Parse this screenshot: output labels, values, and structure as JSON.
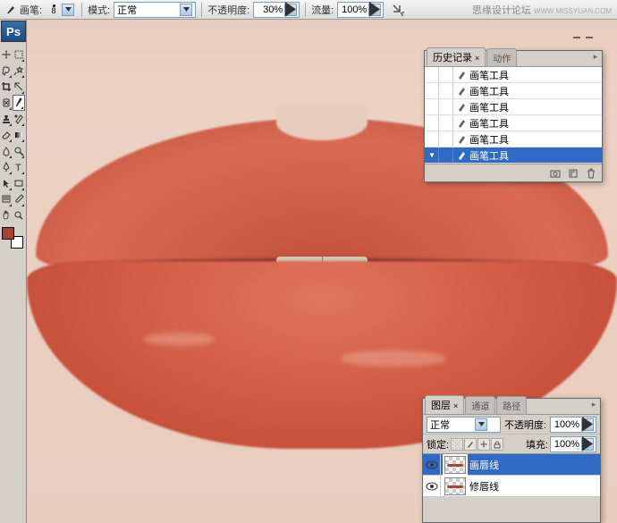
{
  "topbar": {
    "brush_label": "画笔:",
    "brush_size": "8",
    "mode_label": "模式:",
    "mode_value": "正常",
    "opacity_label": "不透明度:",
    "opacity_value": "30%",
    "flow_label": "流量:",
    "flow_value": "100%"
  },
  "watermark": {
    "main": "思缘设计论坛",
    "sub": "WWW.MISSYUAN.COM"
  },
  "tools": [
    "move",
    "marquee",
    "lasso",
    "wand",
    "crop",
    "slice",
    "heal",
    "brush",
    "stamp",
    "history-brush",
    "eraser",
    "gradient",
    "blur",
    "dodge",
    "pen",
    "type",
    "path-select",
    "shape",
    "notes",
    "eyedropper",
    "hand",
    "zoom"
  ],
  "history": {
    "tab1": "历史记录",
    "tab2": "动作",
    "items": [
      {
        "label": "画笔工具"
      },
      {
        "label": "画笔工具"
      },
      {
        "label": "画笔工具"
      },
      {
        "label": "画笔工具"
      },
      {
        "label": "画笔工具"
      },
      {
        "label": "画笔工具",
        "selected": true
      }
    ]
  },
  "layers": {
    "tab1": "图层",
    "tab2": "通道",
    "tab3": "路径",
    "blend_value": "正常",
    "opacity_label": "不透明度:",
    "opacity_value": "100%",
    "lock_label": "锁定:",
    "fill_label": "填充:",
    "fill_value": "100%",
    "items": [
      {
        "label": "画唇线",
        "selected": true
      },
      {
        "label": "修唇线"
      }
    ]
  }
}
